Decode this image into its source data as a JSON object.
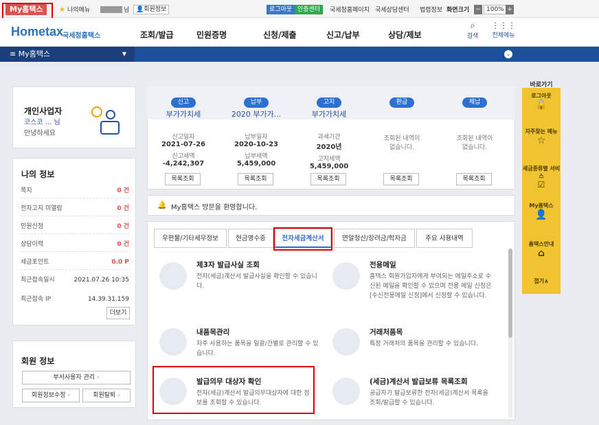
{
  "topbar": {
    "my_hometax": "My홈택스",
    "my_menu": "나의메뉴",
    "user_suffix": "님",
    "member_info": "회원정보",
    "logout": "로그아웃",
    "certificate_center": "인증센터",
    "links": [
      "국세청홈페이지",
      "국세상담센터",
      "법령정보"
    ],
    "screen_size_label": "화면크기",
    "zoom": "100%"
  },
  "header": {
    "logo_text": "Hometax",
    "logo_sub": "국세청홈택스",
    "menu": [
      "조회/발급",
      "민원증명",
      "신청/제출",
      "신고/납부",
      "상담/제보"
    ],
    "search_label": "검색",
    "all_menu_label": "전체메뉴"
  },
  "navbar": {
    "selected": "My홈택스"
  },
  "profile": {
    "type": "개인사업자",
    "name": "코스코 ... 님",
    "greeting": "안녕하세요"
  },
  "my_info": {
    "title": "나의 정보",
    "rows": [
      {
        "label": "쪽지",
        "value": "0 건"
      },
      {
        "label": "전자고지 미열람",
        "value": "0 건"
      },
      {
        "label": "민원신청",
        "value": "0 건"
      },
      {
        "label": "상담이력",
        "value": "0 건"
      },
      {
        "label": "세금포인트",
        "value": "0.0 P"
      }
    ],
    "last_login_label": "최근접속일시",
    "last_login": "2021.07.26 10:35",
    "last_ip_label": "최근접속 IP",
    "last_ip": "14.39.31.159",
    "more": "더보기"
  },
  "member_info": {
    "title": "회원 정보",
    "sub_user_btn": "부서사용자 관리",
    "edit_btn": "회원정보수정",
    "withdraw_btn": "회원탈퇴"
  },
  "tax_summary": [
    {
      "badge": "신고",
      "badge_color": "#2f6fd0",
      "title": "부가가치세",
      "l1": "신고일자",
      "v1": "2021-07-26",
      "l2": "신고세액",
      "v2": "-4,242,307",
      "btn": "목록조회"
    },
    {
      "badge": "납부",
      "badge_color": "#2f6fd0",
      "title": "2020 부가가...",
      "l1": "납부일자",
      "v1": "2020-10-23",
      "l2": "납부세액",
      "v2": "5,459,000",
      "btn": "목록조회"
    },
    {
      "badge": "고지",
      "badge_color": "#2f6fd0",
      "title": "부가가치세",
      "l1": "과세기간",
      "v1": "2020년",
      "l2": "고지세액",
      "v2": "5,459,000",
      "btn": "목록조회"
    },
    {
      "badge": "환급",
      "badge_color": "#2f6fd0",
      "title": "",
      "msg": "조회된 내역이 없습니다.",
      "btn": "목록조회"
    },
    {
      "badge": "체납",
      "badge_color": "#2f6fd0",
      "title": "",
      "msg": "조회된 내역이 없습니다.",
      "btn": "목록조회"
    }
  ],
  "notice": "My홈택스 방문을 환영합니다.",
  "tabs": [
    "우편물/기타세무정보",
    "현금영수증",
    "전자세금계산서",
    "연말정산/장려금/학자금",
    "주요 사용내역"
  ],
  "active_tab_index": 2,
  "services": [
    {
      "title": "제3자 발급사실 조회",
      "desc": "전자(세금)계산서 발급사실을 확인할 수 있습니다.",
      "icon": "document-search-icon"
    },
    {
      "title": "전용메일",
      "desc": "홈택스 회원가입자에게 부여되는 메일주소로 수신된 메일을 확인할 수 있으며 전용 메일 신청은 [수신전용메일 신청]에서 신청할 수 있습니다.",
      "icon": "mail-user-icon"
    },
    {
      "title": "내품목관리",
      "desc": "자주 사용하는 품목을 일괄/건별로 관리할 수 있습니다.",
      "icon": "calendar-coin-icon"
    },
    {
      "title": "거래처품목",
      "desc": "특정 거래처의 품목을 관리할 수 있습니다.",
      "icon": "building-list-icon"
    },
    {
      "title": "발급의무 대상자 확인",
      "desc": "전자(세금)계산서 발급의무대상자에 대한 정보를 조회할 수 있습니다.",
      "icon": "document-magnifier-icon"
    },
    {
      "title": "(세금)계산서 발급보류 목록조회",
      "desc": "공급자가 발급보류한 전자(세금)계산서 목록을 조회/발급할 수 있습니다.",
      "icon": "document-list-icon"
    }
  ],
  "quick_bar": {
    "title": "바로가기",
    "items": [
      "로그아웃",
      "자주찾는 메뉴",
      "세금종류별 서비스",
      "My홈택스",
      "홈택스안내"
    ],
    "close": "접기∧"
  }
}
